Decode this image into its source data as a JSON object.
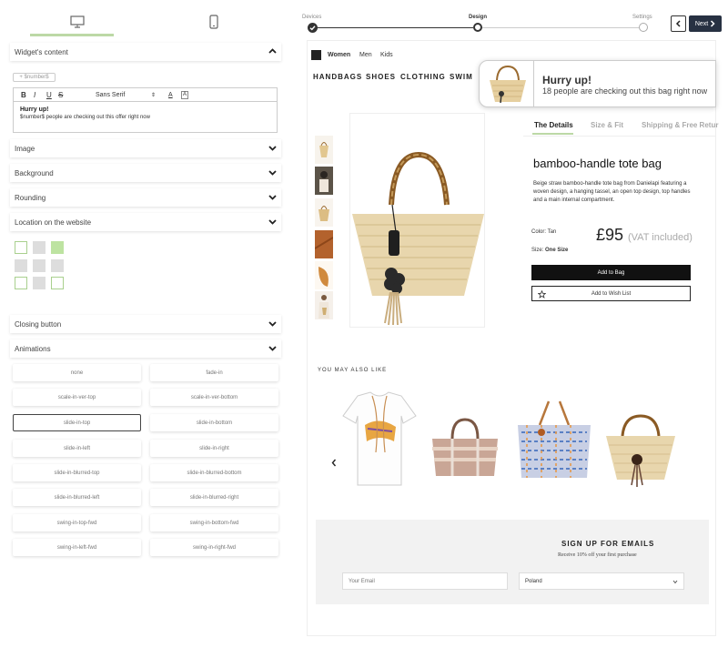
{
  "editor": {
    "chip": "+ $number$",
    "font": "Sans Serif",
    "bold": "B",
    "italic": "I",
    "underline": "U",
    "strike": "S",
    "color": "A",
    "bg": "A",
    "headline": "Hurry up!",
    "body": "$number$ people are checking out this offer right now"
  },
  "panels": {
    "content": "Widget's content",
    "image": "Image",
    "background": "Background",
    "rounding": "Rounding",
    "location": "Location on the website",
    "closing": "Closing button",
    "animations": "Animations"
  },
  "animations": [
    "none",
    "fade-in",
    "scale-in-ver-top",
    "scale-in-ver-bottom",
    "slide-in-top",
    "slide-in-bottom",
    "slide-in-left",
    "slide-in-right",
    "slide-in-blurred-top",
    "slide-in-blurred-bottom",
    "slide-in-blurred-left",
    "slide-in-blurred-right",
    "swing-in-top-fwd",
    "swing-in-bottom-fwd",
    "swing-in-left-fwd",
    "swing-in-right-fwd"
  ],
  "steps": {
    "devices": "Devices",
    "design": "Design",
    "settings": "Settings",
    "next": "Next"
  },
  "site": {
    "women": "Women",
    "men": "Men",
    "kids": "Kids",
    "cats": [
      "HANDBAGS",
      "SHOES",
      "CLOTHING",
      "SWIM"
    ],
    "popup_title": "Hurry up!",
    "popup_text": "18 people are checking out this bag right now",
    "tabs": [
      "The Details",
      "Size & Fit",
      "Shipping & Free Retur"
    ],
    "title": "bamboo-handle tote bag",
    "desc": "Beige straw bamboo-handle tote bag from Danielapi featuring a woven design, a hanging tassel, an open top design, top handles and a main internal compartment.",
    "color_label": "Color:",
    "color": "Tan",
    "price": "£95",
    "vat": "(VAT included)",
    "size_label": "Size:",
    "size": "One Size",
    "add": "Add to Bag",
    "wish": "Add to Wish List",
    "also": "YOU MAY ALSO LIKE",
    "signup_title": "SIGN UP FOR EMAILS",
    "signup_sub": "Receive 10% off your first purchase",
    "email_ph": "Your Email",
    "country": "Poland"
  },
  "colors": {
    "accent": "#bcd9a6",
    "dark": "#273142"
  }
}
